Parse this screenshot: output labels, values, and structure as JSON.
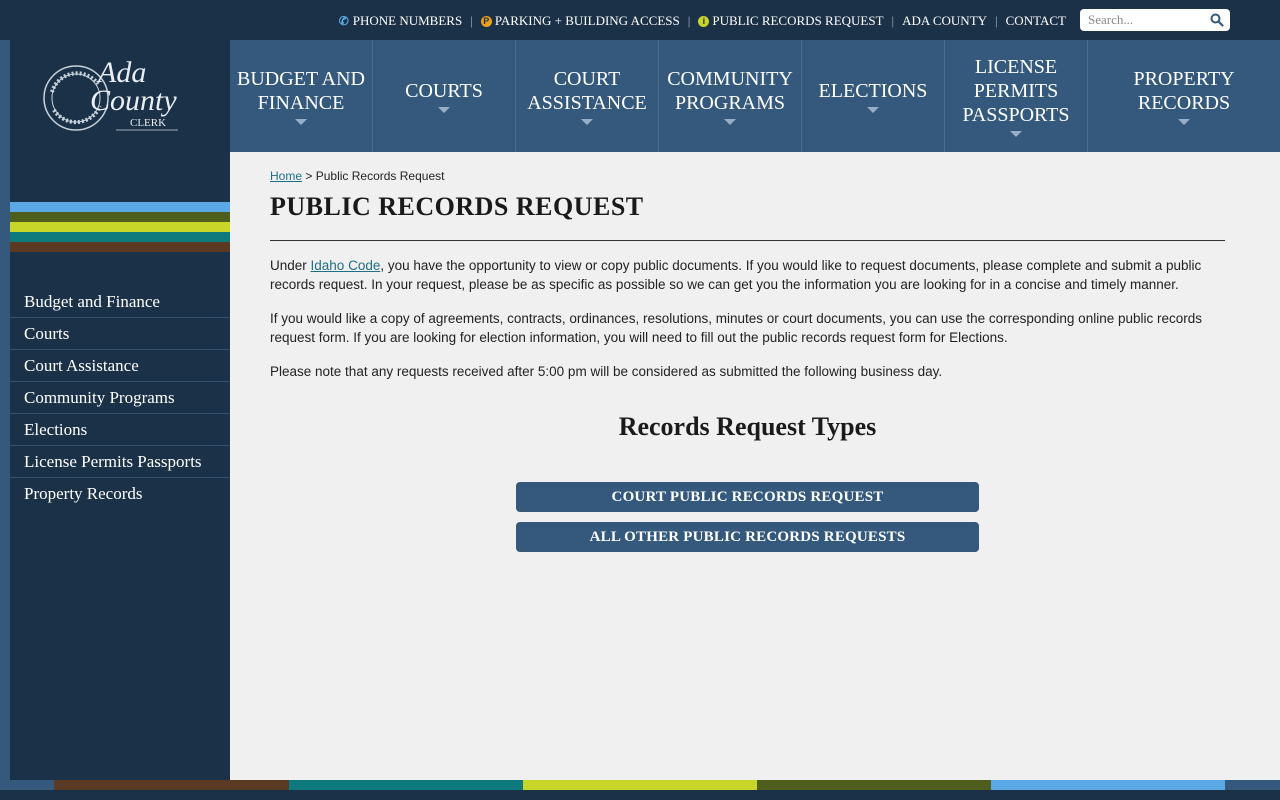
{
  "utility": {
    "links": [
      {
        "label": "PHONE NUMBERS",
        "icon": "phone-icon"
      },
      {
        "label": "PARKING + BUILDING ACCESS",
        "icon": "parking-icon"
      },
      {
        "label": "PUBLIC RECORDS REQUEST",
        "icon": "info-icon"
      },
      {
        "label": "ADA COUNTY",
        "icon": ""
      },
      {
        "label": "CONTACT",
        "icon": ""
      }
    ],
    "search_placeholder": "Search..."
  },
  "logo": {
    "line1": "Ada",
    "line2": "County",
    "line3": "CLERK"
  },
  "nav": {
    "items": [
      {
        "label": "BUDGET AND\nFINANCE"
      },
      {
        "label": "COURTS"
      },
      {
        "label": "COURT\nASSISTANCE"
      },
      {
        "label": "COMMUNITY\nPROGRAMS"
      },
      {
        "label": "ELECTIONS"
      },
      {
        "label": "LICENSE\nPERMITS\nPASSPORTS"
      },
      {
        "label": "PROPERTY\nRECORDS"
      }
    ]
  },
  "sidebar": {
    "stripe_colors": [
      "#5aa9e6",
      "#4f5e1c",
      "#c8d62a",
      "#0f7a7e",
      "#5a3a22"
    ],
    "items": [
      {
        "label": "Budget and Finance"
      },
      {
        "label": "Courts"
      },
      {
        "label": "Court Assistance"
      },
      {
        "label": "Community Programs"
      },
      {
        "label": "Elections"
      },
      {
        "label": "License Permits Passports"
      },
      {
        "label": "Property Records"
      }
    ]
  },
  "breadcrumb": {
    "home": "Home",
    "separator": ">",
    "current": "Public Records Request"
  },
  "page": {
    "title": "PUBLIC RECORDS REQUEST",
    "para1_before": "Under ",
    "para1_link": "Idaho Code",
    "para1_after": ", you have the opportunity to view or copy public documents.  If you would like to request documents, please complete and submit a public records request. In your request, please be as specific as possible so we can get you the information you are looking for in a concise and timely manner.",
    "para2": "If you would like a copy of agreements, contracts, ordinances, resolutions, minutes or court documents, you can use the corresponding online public records request form. If you are looking for election information, you will need to fill out the public records request form for Elections.",
    "para3": "Please note that any requests received after 5:00 pm will be considered as submitted the following business day.",
    "section_heading": "Records Request Types",
    "buttons": {
      "court": "COURT PUBLIC RECORDS REQUEST",
      "other": "ALL OTHER PUBLIC RECORDS REQUESTS"
    }
  },
  "colors": {
    "dark_navy": "#1b3148",
    "nav_blue": "#34597c",
    "link_teal": "#1f6e86",
    "content_bg": "#f0f0f0"
  },
  "footer_stripe_colors": [
    "#34597c",
    "#5a3a22",
    "#0f7a7e",
    "#c8d62a",
    "#4f5e1c",
    "#5aa9e6",
    "#34597c"
  ]
}
